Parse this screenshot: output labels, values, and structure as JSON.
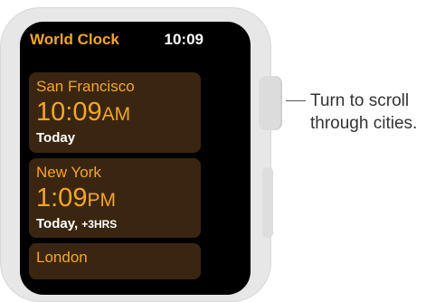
{
  "app": {
    "title": "World Clock",
    "current_time": "10:09"
  },
  "cities": [
    {
      "name": "San Francisco",
      "time": "10:09",
      "ampm": "AM",
      "relative": "Today",
      "offset": ""
    },
    {
      "name": "New York",
      "time": "1:09",
      "ampm": "PM",
      "relative": "Today,",
      "offset": "+3HRS"
    },
    {
      "name": "London"
    }
  ],
  "callout": {
    "line1": "Turn to scroll",
    "line2": "through cities."
  },
  "colors": {
    "accent": "#f5a623",
    "card_bg": "#3a2610",
    "screen_bg": "#000000",
    "case": "#e7e7e7"
  }
}
